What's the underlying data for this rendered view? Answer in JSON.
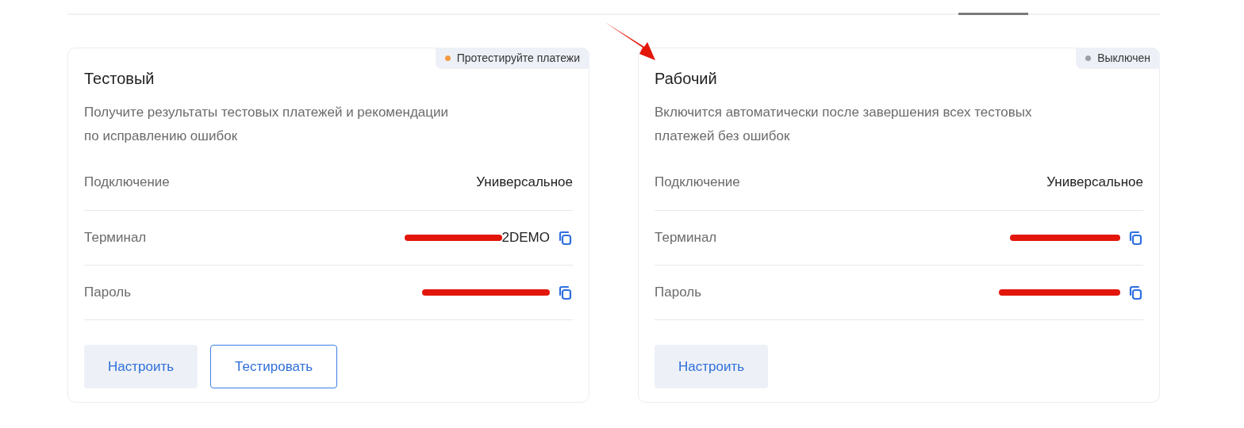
{
  "cards": [
    {
      "badge": {
        "label": "Протестируйте платежи",
        "color": "#f59a45"
      },
      "title": "Тестовый",
      "description": "Получите результаты тестовых платежей и рекомендации\nпо исправлению ошибок",
      "rows": [
        {
          "kind": "text",
          "label": "Подключение",
          "value": "Универсальное"
        },
        {
          "kind": "secret",
          "label": "Терминал",
          "value": "2DEMO",
          "redacted": true
        },
        {
          "kind": "secret",
          "label": "Пароль",
          "redacted": true
        }
      ],
      "buttons": [
        {
          "label": "Настроить",
          "kind": "filled"
        },
        {
          "label": "Тестировать",
          "kind": "outline"
        }
      ]
    },
    {
      "badge": {
        "label": "Выключен",
        "color": "#9aa0a8"
      },
      "title": "Рабочий",
      "description": "Включится автоматически после завершения всех тестовых\nплатежей без ошибок",
      "rows": [
        {
          "kind": "text",
          "label": "Подключение",
          "value": "Универсальное"
        },
        {
          "kind": "secret",
          "label": "Терминал",
          "redacted": true
        },
        {
          "kind": "secret",
          "label": "Пароль",
          "redacted": true
        }
      ],
      "buttons": [
        {
          "label": "Настроить",
          "kind": "filled"
        }
      ]
    }
  ]
}
